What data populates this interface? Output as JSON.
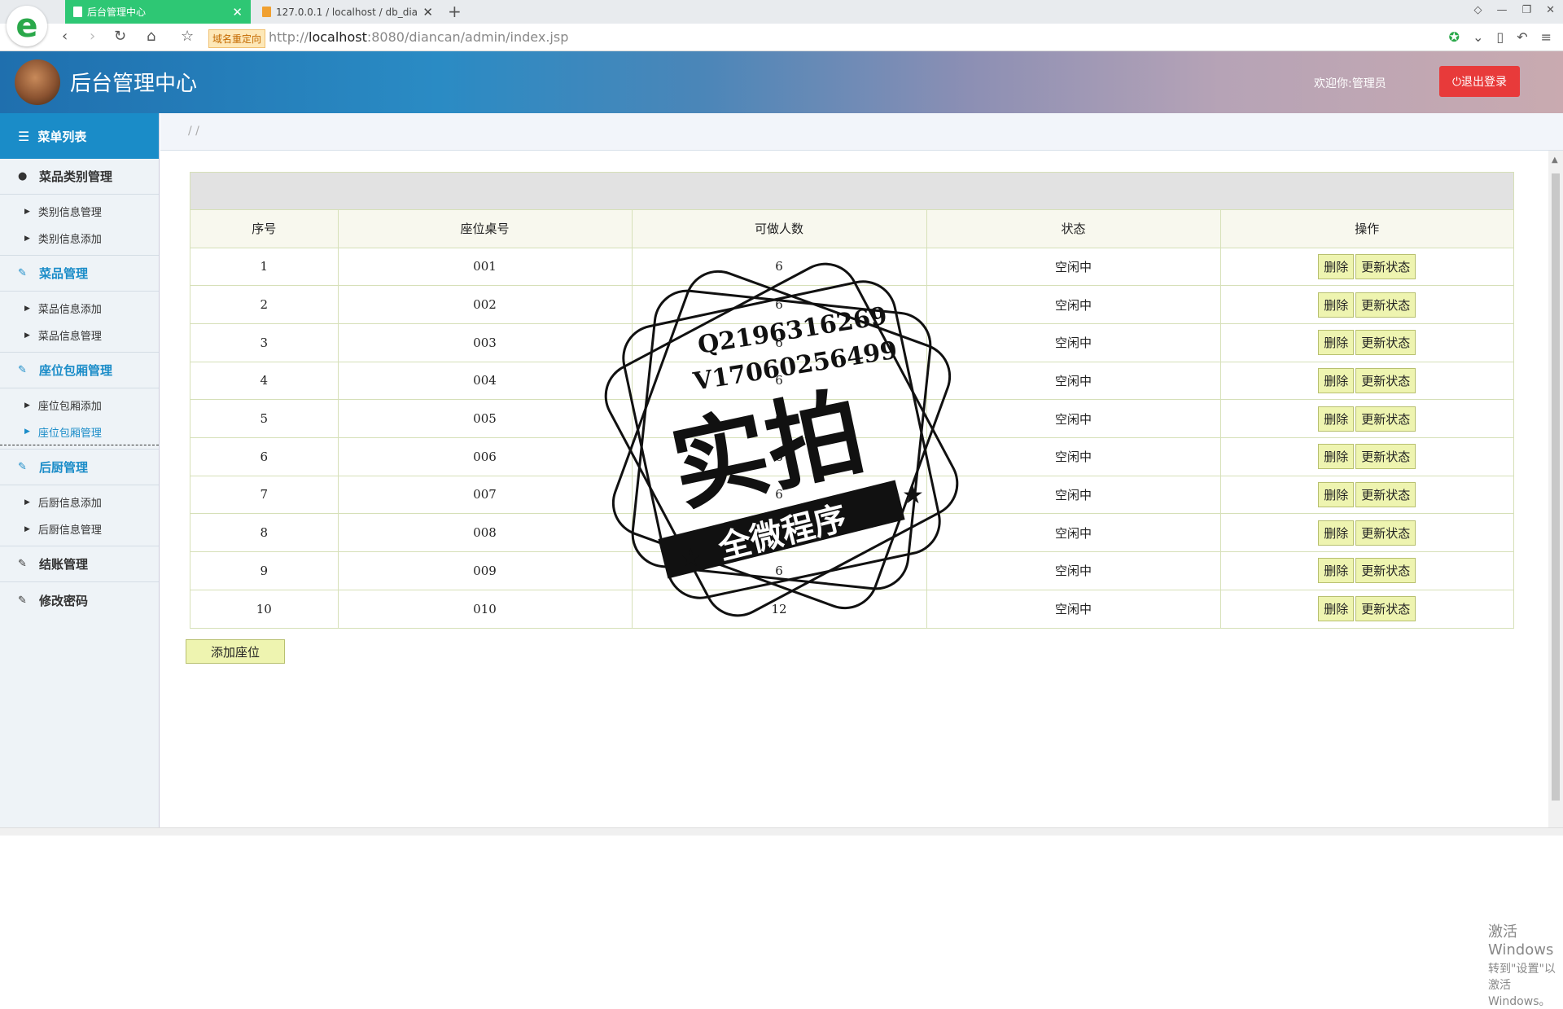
{
  "browser": {
    "tabs": [
      {
        "label": "后台管理中心",
        "active": true
      },
      {
        "label": "127.0.0.1 / localhost / db_dia",
        "active": false
      }
    ],
    "redirect_badge": "域名重定向",
    "url_prefix": "http://",
    "url_host": "localhost",
    "url_rest": ":8080/diancan/admin/index.jsp"
  },
  "header": {
    "title": "后台管理中心",
    "welcome": "欢迎你:管理员",
    "logout_label": "退出登录"
  },
  "sidebar": {
    "menu_title": "菜单列表",
    "groups": [
      {
        "label": "菜品类别管理",
        "items": [
          "类别信息管理",
          "类别信息添加"
        ]
      },
      {
        "label": "菜品管理",
        "items": [
          "菜品信息添加",
          "菜品信息管理"
        ]
      },
      {
        "label": "座位包厢管理",
        "items": [
          "座位包厢添加",
          "座位包厢管理"
        ]
      },
      {
        "label": "后厨管理",
        "items": [
          "后厨信息添加",
          "后厨信息管理"
        ]
      },
      {
        "label": "结账管理",
        "items": []
      },
      {
        "label": "修改密码",
        "items": []
      }
    ]
  },
  "breadcrumb": "/ /",
  "table": {
    "headers": [
      "序号",
      "座位桌号",
      "可做人数",
      "状态",
      "操作"
    ],
    "rows": [
      {
        "no": "1",
        "seat": "001",
        "capacity": "6",
        "status": "空闲中"
      },
      {
        "no": "2",
        "seat": "002",
        "capacity": "6",
        "status": "空闲中"
      },
      {
        "no": "3",
        "seat": "003",
        "capacity": "6",
        "status": "空闲中"
      },
      {
        "no": "4",
        "seat": "004",
        "capacity": "6",
        "status": "空闲中"
      },
      {
        "no": "5",
        "seat": "005",
        "capacity": "6",
        "status": "空闲中"
      },
      {
        "no": "6",
        "seat": "006",
        "capacity": "6",
        "status": "空闲中"
      },
      {
        "no": "7",
        "seat": "007",
        "capacity": "6",
        "status": "空闲中"
      },
      {
        "no": "8",
        "seat": "008",
        "capacity": "6",
        "status": "空闲中"
      },
      {
        "no": "9",
        "seat": "009",
        "capacity": "6",
        "status": "空闲中"
      },
      {
        "no": "10",
        "seat": "010",
        "capacity": "12",
        "status": "空闲中"
      }
    ],
    "delete_label": "删除",
    "update_label": "更新状态"
  },
  "add_seat_label": "添加座位",
  "watermark": {
    "line1": "Q2196316269",
    "line2": "V17060256499",
    "big": "实拍",
    "banner": "全微程序"
  },
  "activation": {
    "line1": "激活 Windows",
    "line2": "转到\"设置\"以激活 Windows。"
  }
}
